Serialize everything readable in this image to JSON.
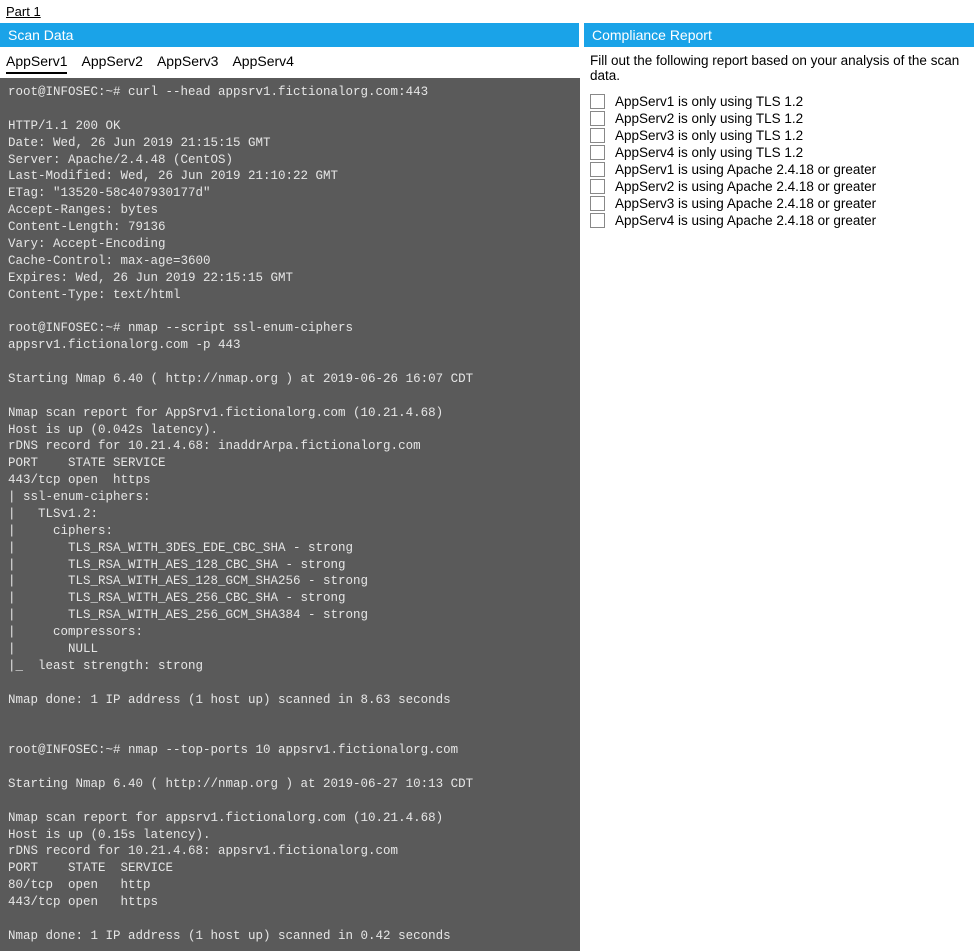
{
  "part_label": "Part 1",
  "left": {
    "header": "Scan Data",
    "tabs": [
      "AppServ1",
      "AppServ2",
      "AppServ3",
      "AppServ4"
    ],
    "active_tab": 0,
    "terminal": "root@INFOSEC:~# curl --head appsrv1.fictionalorg.com:443\n\nHTTP/1.1 200 OK\nDate: Wed, 26 Jun 2019 21:15:15 GMT\nServer: Apache/2.4.48 (CentOS)\nLast-Modified: Wed, 26 Jun 2019 21:10:22 GMT\nETag: \"13520-58c407930177d\"\nAccept-Ranges: bytes\nContent-Length: 79136\nVary: Accept-Encoding\nCache-Control: max-age=3600\nExpires: Wed, 26 Jun 2019 22:15:15 GMT\nContent-Type: text/html\n\nroot@INFOSEC:~# nmap --script ssl-enum-ciphers\nappsrv1.fictionalorg.com -p 443\n\nStarting Nmap 6.40 ( http://nmap.org ) at 2019-06-26 16:07 CDT\n\nNmap scan report for AppSrv1.fictionalorg.com (10.21.4.68)\nHost is up (0.042s latency).\nrDNS record for 10.21.4.68: inaddrArpa.fictionalorg.com\nPORT    STATE SERVICE\n443/tcp open  https\n| ssl-enum-ciphers:\n|   TLSv1.2:\n|     ciphers:\n|       TLS_RSA_WITH_3DES_EDE_CBC_SHA - strong\n|       TLS_RSA_WITH_AES_128_CBC_SHA - strong\n|       TLS_RSA_WITH_AES_128_GCM_SHA256 - strong\n|       TLS_RSA_WITH_AES_256_CBC_SHA - strong\n|       TLS_RSA_WITH_AES_256_GCM_SHA384 - strong\n|     compressors:\n|       NULL\n|_  least strength: strong\n\nNmap done: 1 IP address (1 host up) scanned in 8.63 seconds\n\n\nroot@INFOSEC:~# nmap --top-ports 10 appsrv1.fictionalorg.com\n\nStarting Nmap 6.40 ( http://nmap.org ) at 2019-06-27 10:13 CDT\n\nNmap scan report for appsrv1.fictionalorg.com (10.21.4.68)\nHost is up (0.15s latency).\nrDNS record for 10.21.4.68: appsrv1.fictionalorg.com\nPORT    STATE  SERVICE\n80/tcp  open   http\n443/tcp open   https\n\nNmap done: 1 IP address (1 host up) scanned in 0.42 seconds"
  },
  "right": {
    "header": "Compliance Report",
    "intro": "Fill out the following report based on your analysis of the scan data.",
    "items": [
      "AppServ1 is only using TLS 1.2",
      "AppServ2 is only using TLS 1.2",
      "AppServ3 is only using TLS 1.2",
      "AppServ4 is only using TLS 1.2",
      "AppServ1 is using Apache 2.4.18 or greater",
      "AppServ2 is using Apache 2.4.18 or greater",
      "AppServ3 is using Apache 2.4.18 or greater",
      "AppServ4 is using Apache 2.4.18 or greater"
    ]
  }
}
